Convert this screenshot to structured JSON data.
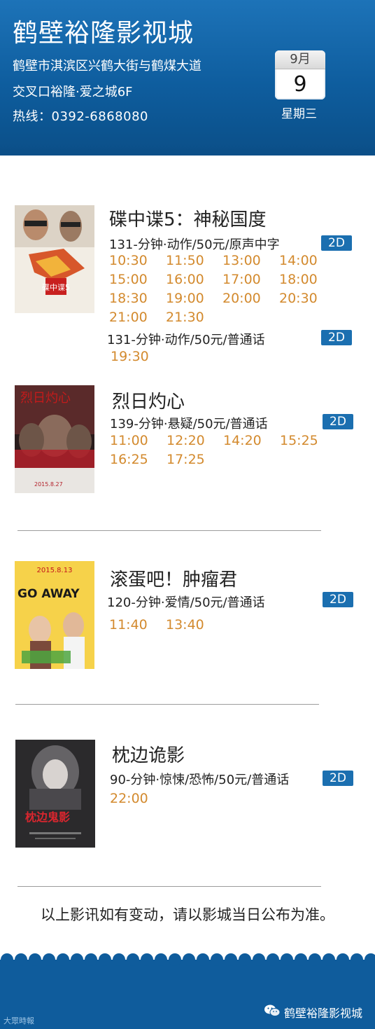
{
  "header": {
    "cinema_name": "鹤壁裕隆影视城",
    "address_line1": "鹤壁市淇滨区兴鹤大街与鹤煤大道",
    "address_line2": "交叉口裕隆·爱之城6F",
    "hotline": "热线：0392-6868080",
    "date": {
      "month": "9月",
      "day": "9",
      "weekday": "星期三"
    }
  },
  "colors": {
    "brand_blue": "#0e5d9e",
    "time_orange": "#d38a2e",
    "badge_blue": "#1b6fb0"
  },
  "movies": [
    {
      "title": "碟中谍5：神秘国度",
      "poster_text": "碟中谍5",
      "sessions": [
        {
          "info": "131-分钟·动作/50元/原声中字",
          "format": "2D",
          "times": [
            "10:30",
            "11:50",
            "13:00",
            "14:00",
            "15:00",
            "16:00",
            "17:00",
            "18:00",
            "18:30",
            "19:00",
            "20:00",
            "20:30",
            "21:00",
            "21:30"
          ]
        },
        {
          "info": "131-分钟·动作/50元/普通话",
          "format": "2D",
          "times": [
            "19:30"
          ]
        }
      ]
    },
    {
      "title": "烈日灼心",
      "poster_text": "烈日灼心",
      "poster_date": "2015.8.27",
      "sessions": [
        {
          "info": "139-分钟·悬疑/50元/普通话",
          "format": "2D",
          "times": [
            "11:00",
            "12:20",
            "14:20",
            "15:25",
            "16:25",
            "17:25"
          ]
        }
      ]
    },
    {
      "title": "滚蛋吧！肿瘤君",
      "poster_text": "GO AWAY",
      "poster_date": "2015.8.13",
      "sessions": [
        {
          "info": "120-分钟·爱情/50元/普通话",
          "format": "2D",
          "times": [
            "11:40",
            "13:40"
          ]
        }
      ]
    },
    {
      "title": "枕边诡影",
      "poster_text": "枕边鬼影",
      "sessions": [
        {
          "info": "90-分钟·惊悚/恐怖/50元/普通话",
          "format": "2D",
          "times": [
            "22:00"
          ]
        }
      ]
    }
  ],
  "notice": "以上影讯如有变动，请以影城当日公布为准。",
  "footer": {
    "left_logo_text": "大眾時報",
    "account_name": "鹤壁裕隆影视城"
  }
}
